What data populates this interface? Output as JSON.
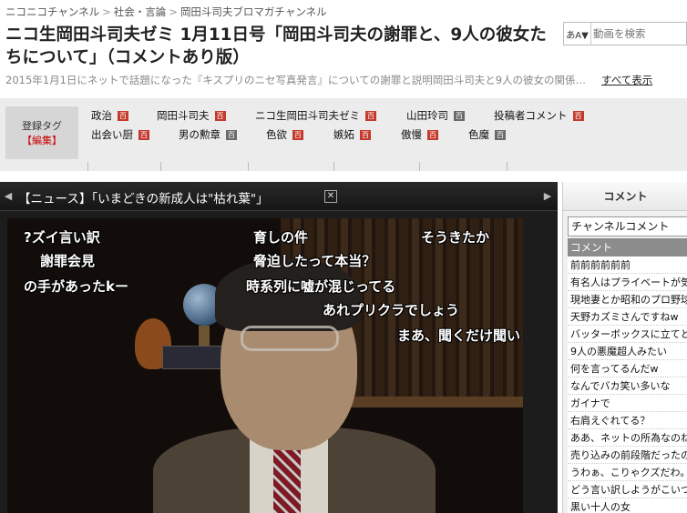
{
  "breadcrumb": {
    "items": [
      "ニコニコチャンネル",
      "社会・言論",
      "岡田斗司夫ブロマガチャンネル"
    ],
    "separator": ">"
  },
  "title": "ニコ生岡田斗司夫ゼミ 1月11日号「岡田斗司夫の謝罪と、9人の彼女たちについて」（コメントあり版）",
  "description": "2015年1月1日にネットで話題になった『キスプリのニセ写真発言』についての謝罪と説明岡田斗司夫と9人の彼女の関係…",
  "show_all_label": "すべて表示",
  "search": {
    "type_label": "あA▼",
    "placeholder": "動画を検索"
  },
  "tags": {
    "register_label": "登録タグ",
    "edit_label": "【編集】",
    "items": [
      {
        "label": "政治",
        "icon": "red"
      },
      {
        "label": "岡田斗司夫",
        "icon": "red"
      },
      {
        "label": "ニコ生岡田斗司夫ゼミ",
        "icon": "red"
      },
      {
        "label": "山田玲司",
        "icon": "gray"
      },
      {
        "label": "投稿者コメント",
        "icon": "red"
      },
      {
        "label": "出会い厨",
        "icon": "red"
      },
      {
        "label": "男の勲章",
        "icon": "gray"
      },
      {
        "label": "色欲",
        "icon": "red"
      },
      {
        "label": "嫉妬",
        "icon": "red"
      },
      {
        "label": "傲慢",
        "icon": "red"
      },
      {
        "label": "色魔",
        "icon": "gray"
      }
    ]
  },
  "player": {
    "news_text": "【ニュース】「いまどきの新成人は\"枯れ葉\"」",
    "comments": [
      "?ズイ言い訳",
      "育しの件",
      "そうきたか",
      "謝罪会見",
      "脅迫したって本当？",
      "の手があったkー",
      "時系列に嘘が混じってる",
      "あれプリクラでしょう",
      "まあ、聞くだけ聞い"
    ]
  },
  "sidebar": {
    "title": "コメント",
    "select_value": "チャンネルコメント",
    "header": "コメント",
    "comments": [
      "前前前前前前",
      "有名人はプライベートが気",
      "現地妻とか昭和のプロ野球",
      "天野カズミさんですねw",
      "バッターボックスに立てと",
      "9人の悪魔超人みたい",
      "何を言ってるんだw",
      "なんでバカ笑い多いな",
      "ガイナで",
      "右肩えぐれてる？",
      "ああ、ネットの所為なのね",
      "売り込みの前段階だったの",
      "うわぁ、こりゃクズだわ。",
      "どう言い訳しようがこいつ",
      "黒い十人の女"
    ]
  },
  "colors": {
    "tag_icon_red": "#c43a2c",
    "tag_icon_gray": "#6a6a6a",
    "tag_edit": "#cc0000",
    "player_bg": "#1c1c1c"
  }
}
